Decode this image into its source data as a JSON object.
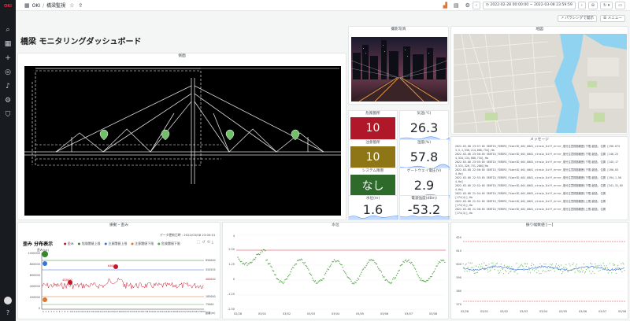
{
  "app": {
    "logo": "OKI"
  },
  "breadcrumb": {
    "root": "OKI",
    "current": "橋梁監視"
  },
  "timerange": "2022-02-28 00:00:00 ~ 2022-03-08 23:59:59",
  "subbar": {
    "panel_link": "パラシングで開示",
    "menu": "メニュー"
  },
  "dashboard_title": "橋梁 モニタリングダッシュボード",
  "panels": {
    "side_view": "側面",
    "photo": "撮影写真",
    "map": "地図",
    "messages": "メッセージ",
    "strain": "振動・歪み",
    "water": "水位",
    "vibration": "振り幅数値 [---]"
  },
  "stats": [
    {
      "label": "危険箇所",
      "value": "10",
      "color": "#b0182a"
    },
    {
      "label": "気温(℃)",
      "value": "26.3"
    },
    {
      "label": "注意箇所",
      "value": "10",
      "color": "#8e7617"
    },
    {
      "label": "湿度(%)",
      "value": "57.8"
    },
    {
      "label": "システム障害",
      "value": "なし",
      "color": "#2e6b2a"
    },
    {
      "label": "ゲートウェイ電圧(V)",
      "value": "2.9"
    },
    {
      "label": "水位(m)",
      "value": "1.6"
    },
    {
      "label": "電波強度(dBm)",
      "value": "-53.2"
    }
  ],
  "messages": [
    "2022-03-08 23:57:05  SENTIO_FIBER3_FiberID_001_0001_strain_Diff_error_基分注意振動範囲(下限)超過, 位置 [190.074 3,5,1,536,114,000,734],Ha",
    "2022-03-08 23:56:05  SENTIO_FIBER3_FiberID_001_0001_strain_Diff_error_基分注意振動範囲(下限)超過, 位置 [146,23 4,534,134,000,734],Ha",
    "2022-03-08 23:55:05  SENTIO_FIBER3_FiberID_001_0001_strain_Diff_error_基分注意振動範囲(下限)超過, 位置 [145,17 3,531,326,731,2001]Ha",
    "2022-03-08 22:56:05  SENTIO_FIBER3_FiberID_001_0001_strain_Diff_error_基分注意振動範囲(下限)超過, 位置 [190,03 4,Ha]",
    "2022-03-08 22:53:05  SENTIO_FIBER3_FiberID_001_0001_strain_Diff_error_基分注意振動範囲(下限)超過, 位置 [194,1,56 4,Ha]",
    "2022-03-08 22:52:05  SENTIO_FIBER3_FiberID_001_0001_strain_Diff_error_基分注意振動範囲(下限)超過, 位置 [341,31,05 4,Ha]",
    "2022-03-08 21:54:05  SENTIO_FIBER3_FiberID_001_0001_strain_Diff_error_基分注意振動範囲(下限)超過, 位置 [174(4)],Ha",
    "2022-03-08 21:51:05  SENTIO_FIBER3_FiberID_001_0001_strain_Diff_error_基分注意振動範囲(上限)超過, 位置 [174(4)],Ha",
    "2022-03-08 21:50:05  SENTIO_FIBER3_FiberID_001_0001_strain_Diff_error_基分注意振動範囲(上限)超過, 位置 [174(4)],Ha"
  ],
  "strain": {
    "title": "歪み 分布表示",
    "updated": "データ更新日時 : 2022/03/08 23:00:01",
    "unit": "歪み(με)",
    "xlabel": "距離(m)",
    "legend": [
      "歪み",
      "危険閾値上限",
      "注意閾値上限",
      "注意閾値下限",
      "危険閾値下限"
    ],
    "legend_colors": [
      "#c4162a",
      "#37872d",
      "#3274d9",
      "#e0752d",
      "#56a64b"
    ],
    "y_ticks": [
      "1000000",
      "800000",
      "600000",
      "400000",
      "200000",
      "0"
    ],
    "line_labels": [
      "850000",
      "555555",
      "400000",
      "185000",
      "75000"
    ],
    "markers": [
      "640000",
      "455000"
    ]
  },
  "water": {
    "y_ticks": [
      "4",
      "2.50",
      "1.25",
      "0",
      "-1.25",
      "-2.50"
    ],
    "x_ticks": [
      "02/28",
      "03/01",
      "03/02",
      "03/03",
      "03/04",
      "03/05",
      "03/06",
      "03/07",
      "03/08"
    ],
    "threshold": 2.5
  },
  "vibration": {
    "y_ticks": [
      "620",
      "610",
      "600",
      "590",
      "580",
      "570"
    ],
    "x_ticks": [
      "02/28",
      "03/01",
      "03/02",
      "03/03",
      "03/04",
      "03/05",
      "03/06",
      "03/07",
      "03/08"
    ]
  }
}
